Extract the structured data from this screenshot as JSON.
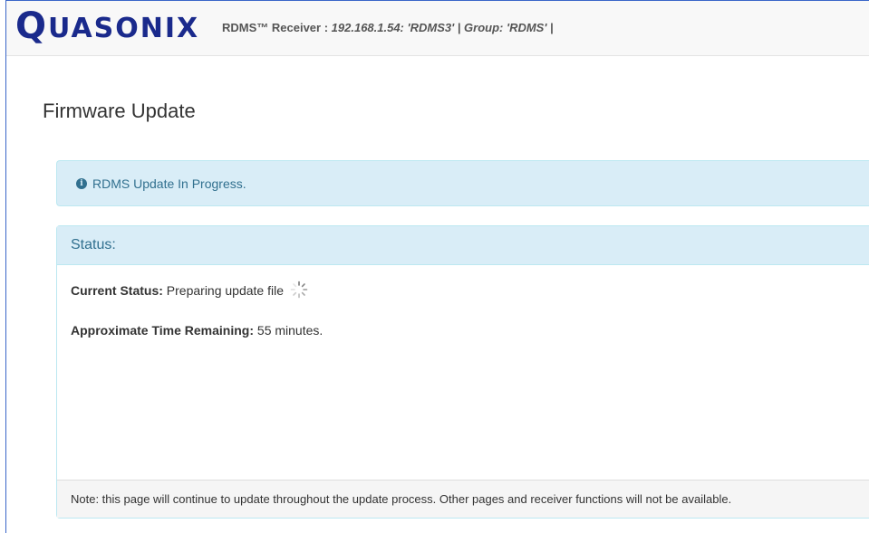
{
  "header": {
    "logo_initial": "Q",
    "logo_rest": "uasonix",
    "device_label": "RDMS™ Receiver : ",
    "device_info": "192.168.1.54: 'RDMS3' | Group: 'RDMS' ",
    "separator": "|"
  },
  "page": {
    "title": "Firmware Update"
  },
  "alert": {
    "icon": "info-circle-icon",
    "message": "RDMS Update In Progress."
  },
  "status_panel": {
    "heading": "Status:",
    "current_status_label": "Current Status:",
    "current_status_value": " Preparing update file",
    "spinner_icon": "loading-spinner-icon",
    "time_remaining_label": "Approximate Time Remaining:",
    "time_remaining_value": " 55 minutes.",
    "note": "Note: this page will continue to update throughout the update process. Other pages and receiver functions will not be available."
  },
  "colors": {
    "brand": "#1a2a8c",
    "info_bg": "#d9edf7",
    "info_text": "#31708f",
    "info_border": "#bce8f1"
  }
}
